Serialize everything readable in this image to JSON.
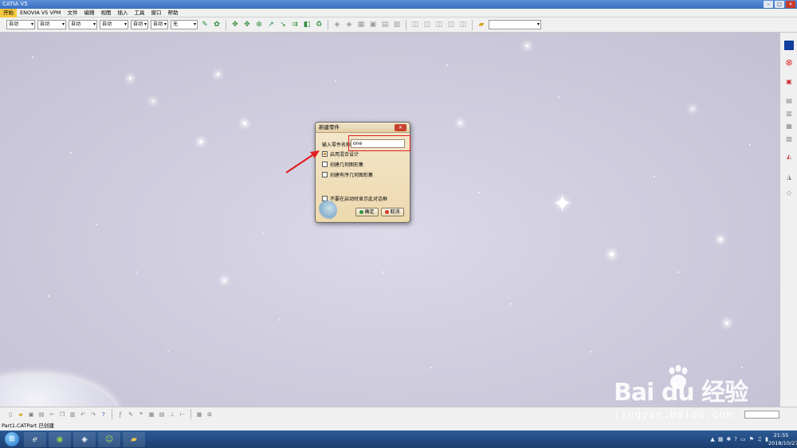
{
  "window": {
    "title": "CATIA V5"
  },
  "menubar": {
    "items": [
      {
        "label": "开始"
      },
      {
        "label": "ENOVIA V5 VPM"
      },
      {
        "label": "文件"
      },
      {
        "label": "编辑"
      },
      {
        "label": "视图"
      },
      {
        "label": "插入"
      },
      {
        "label": "工具"
      },
      {
        "label": "窗口"
      },
      {
        "label": "帮助"
      }
    ]
  },
  "toolbar": {
    "dropdowns": [
      {
        "value": "自动"
      },
      {
        "value": "自动"
      },
      {
        "value": "自动"
      },
      {
        "value": "自动"
      },
      {
        "value": "自动"
      },
      {
        "value": "自动"
      },
      {
        "value": "无"
      }
    ]
  },
  "dialog": {
    "title": "新建零件",
    "name_label": "输入零件名称",
    "name_value": "one",
    "options": [
      {
        "label": "启用混合设计",
        "checked": true
      },
      {
        "label": "创建几何图形集",
        "checked": false
      },
      {
        "label": "创建有序几何图形集",
        "checked": false
      }
    ],
    "dont_show_label": "不要在启动时显示此对话框",
    "ok_label": "确定",
    "cancel_label": "取消"
  },
  "statusbar": {
    "text": "Part1.CATPart 已创建"
  },
  "taskbar": {
    "time": "21:55",
    "date": "2018/10/27"
  },
  "watermark": {
    "main": "Bai du 经验",
    "sub": "jingyan.baidu.com"
  },
  "colors": {
    "highlight": "#e02020",
    "accent": "#f5c842",
    "dialog_bg": "#eed9ae"
  }
}
